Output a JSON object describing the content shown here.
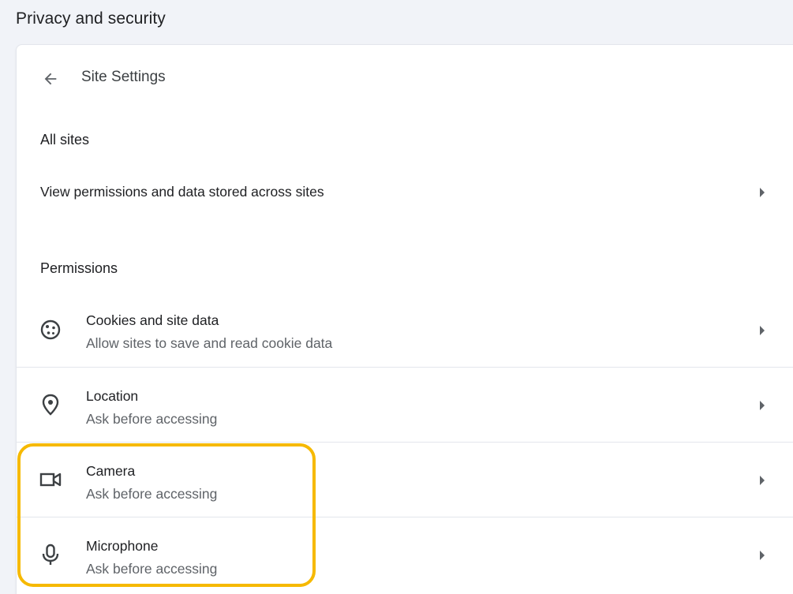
{
  "section": {
    "title": "Privacy and security"
  },
  "header": {
    "title": "Site Settings",
    "back_icon": "arrow-left-icon"
  },
  "all_sites": {
    "heading": "All sites",
    "link_label": "View permissions and data stored across sites"
  },
  "permissions": {
    "heading": "Permissions",
    "items": [
      {
        "title": "Cookies and site data",
        "subtitle": "Allow sites to save and read cookie data",
        "icon": "cookie-icon"
      },
      {
        "title": "Location",
        "subtitle": "Ask before accessing",
        "icon": "location-pin-icon"
      },
      {
        "title": "Camera",
        "subtitle": "Ask before accessing",
        "icon": "camera-icon"
      },
      {
        "title": "Microphone",
        "subtitle": "Ask before accessing",
        "icon": "microphone-icon"
      }
    ]
  },
  "colors": {
    "highlight": "#f6b900",
    "text_primary": "#202124",
    "text_secondary": "#5f6368",
    "divider": "#e3e6ec",
    "background": "#f1f3f8"
  }
}
